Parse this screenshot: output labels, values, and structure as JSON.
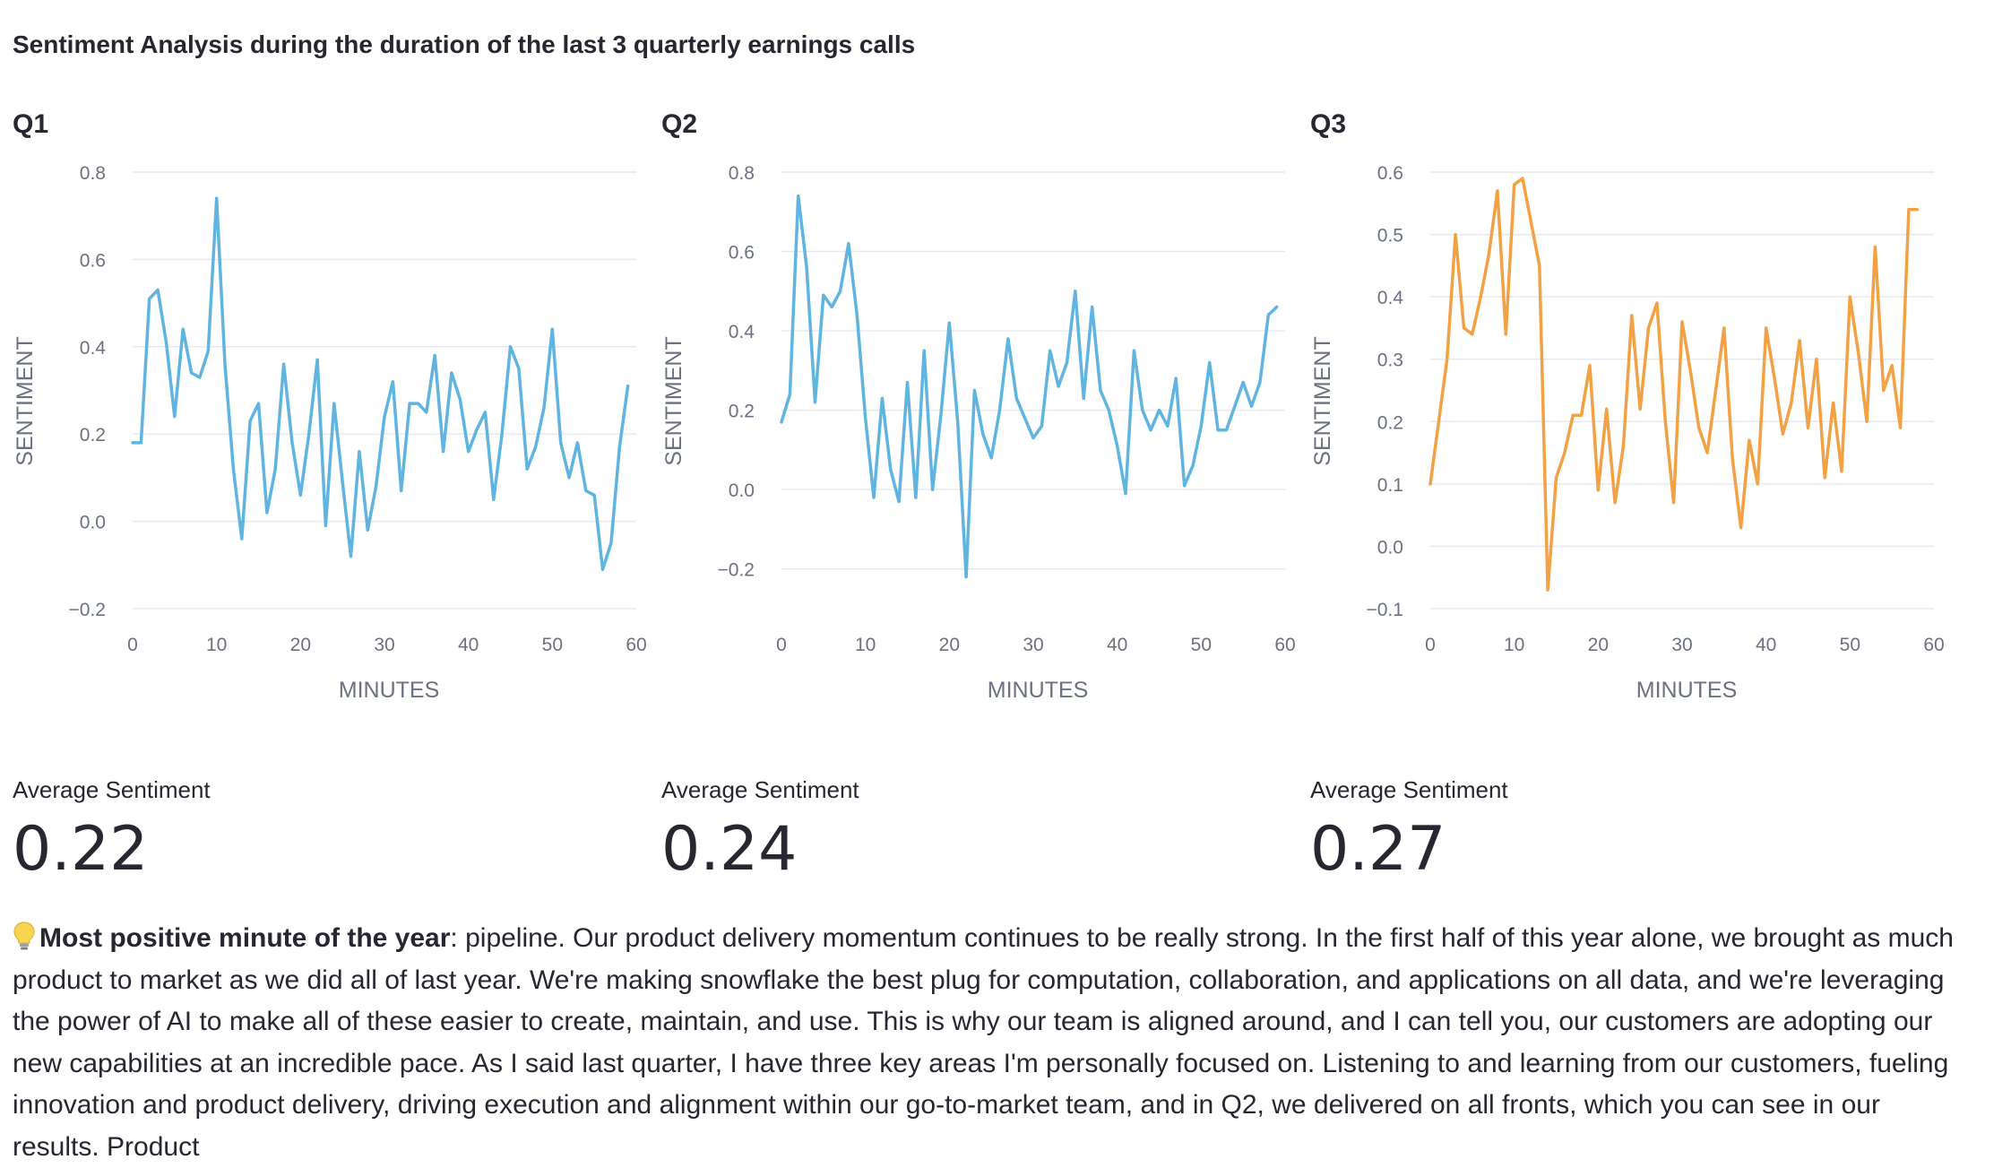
{
  "page": {
    "title": "Sentiment Analysis during the duration of the last 3 quarterly earnings calls"
  },
  "panels": [
    {
      "label": "Q1",
      "avg_label": "Average Sentiment",
      "avg_value": "0.22"
    },
    {
      "label": "Q2",
      "avg_label": "Average Sentiment",
      "avg_value": "0.24"
    },
    {
      "label": "Q3",
      "avg_label": "Average Sentiment",
      "avg_value": "0.27"
    }
  ],
  "insight": {
    "icon": "lightbulb-icon",
    "heading": "Most positive minute of the year",
    "text": ": pipeline. Our product delivery momentum continues to be really strong. In the first half of this year alone, we brought as much product to market as we did all of last year. We're making snowflake the best plug for computation, collaboration, and applications on all data, and we're leveraging the power of AI to make all of these easier to create, maintain, and use. This is why our team is aligned around, and I can tell you, our customers are adopting our new capabilities at an incredible pace. As I said last quarter, I have three key areas I'm personally focused on. Listening to and learning from our customers, fueling innovation and product delivery, driving execution and alignment within our go-to-market team, and in Q2, we delivered on all fronts, which you can see in our results. Product"
  },
  "chart_data": [
    {
      "type": "line",
      "xlabel": "MINUTES",
      "ylabel": "SENTIMENT",
      "xlim": [
        0,
        60
      ],
      "ylim": [
        -0.2,
        0.8
      ],
      "xticks": [
        0,
        10,
        20,
        30,
        40,
        50,
        60
      ],
      "yticks": [
        -0.2,
        0.0,
        0.2,
        0.4,
        0.6,
        0.8
      ],
      "ytick_labels": [
        "−0.2",
        "0.0",
        "0.2",
        "0.4",
        "0.6",
        "0.8"
      ],
      "grid": true,
      "color": "#5fb4e0",
      "x": [
        0,
        1,
        2,
        3,
        4,
        5,
        6,
        7,
        8,
        9,
        10,
        11,
        12,
        13,
        14,
        15,
        16,
        17,
        18,
        19,
        20,
        21,
        22,
        23,
        24,
        25,
        26,
        27,
        28,
        29,
        30,
        31,
        32,
        33,
        34,
        35,
        36,
        37,
        38,
        39,
        40,
        41,
        42,
        43,
        44,
        45,
        46,
        47,
        48,
        49,
        50,
        51,
        52,
        53,
        54,
        55,
        56,
        57,
        58,
        59
      ],
      "y": [
        0.18,
        0.18,
        0.51,
        0.53,
        0.41,
        0.24,
        0.44,
        0.34,
        0.33,
        0.39,
        0.74,
        0.36,
        0.12,
        -0.04,
        0.23,
        0.27,
        0.02,
        0.12,
        0.36,
        0.18,
        0.06,
        0.2,
        0.37,
        -0.01,
        0.27,
        0.09,
        -0.08,
        0.16,
        -0.02,
        0.08,
        0.24,
        0.32,
        0.07,
        0.27,
        0.27,
        0.25,
        0.38,
        0.16,
        0.34,
        0.28,
        0.16,
        0.21,
        0.25,
        0.05,
        0.2,
        0.4,
        0.35,
        0.12,
        0.17,
        0.26,
        0.44,
        0.18,
        0.1,
        0.18,
        0.07,
        0.06,
        -0.11,
        -0.05,
        0.17,
        0.31
      ]
    },
    {
      "type": "line",
      "xlabel": "MINUTES",
      "ylabel": "SENTIMENT",
      "xlim": [
        0,
        60
      ],
      "ylim": [
        -0.3,
        0.8
      ],
      "xticks": [
        0,
        10,
        20,
        30,
        40,
        50,
        60
      ],
      "yticks": [
        -0.2,
        0.0,
        0.2,
        0.4,
        0.6,
        0.8
      ],
      "ytick_labels": [
        "−0.2",
        "0.0",
        "0.2",
        "0.4",
        "0.6",
        "0.8"
      ],
      "grid": true,
      "color": "#5fb4e0",
      "x": [
        0,
        1,
        2,
        3,
        4,
        5,
        6,
        7,
        8,
        9,
        10,
        11,
        12,
        13,
        14,
        15,
        16,
        17,
        18,
        19,
        20,
        21,
        22,
        23,
        24,
        25,
        26,
        27,
        28,
        29,
        30,
        31,
        32,
        33,
        34,
        35,
        36,
        37,
        38,
        39,
        40,
        41,
        42,
        43,
        44,
        45,
        46,
        47,
        48,
        49,
        50,
        51,
        52,
        53,
        54,
        55,
        56,
        57,
        58,
        59
      ],
      "y": [
        0.17,
        0.24,
        0.74,
        0.56,
        0.22,
        0.49,
        0.46,
        0.5,
        0.62,
        0.44,
        0.18,
        -0.02,
        0.23,
        0.05,
        -0.03,
        0.27,
        -0.02,
        0.35,
        0.0,
        0.19,
        0.42,
        0.17,
        -0.22,
        0.25,
        0.14,
        0.08,
        0.2,
        0.38,
        0.23,
        0.18,
        0.13,
        0.16,
        0.35,
        0.26,
        0.32,
        0.5,
        0.23,
        0.46,
        0.25,
        0.2,
        0.11,
        -0.01,
        0.35,
        0.2,
        0.15,
        0.2,
        0.16,
        0.28,
        0.01,
        0.06,
        0.16,
        0.32,
        0.15,
        0.15,
        0.21,
        0.27,
        0.21,
        0.27,
        0.44,
        0.46
      ]
    },
    {
      "type": "line",
      "xlabel": "MINUTES",
      "ylabel": "SENTIMENT",
      "xlim": [
        0,
        60
      ],
      "ylim": [
        -0.1,
        0.6
      ],
      "xticks": [
        0,
        10,
        20,
        30,
        40,
        50,
        60
      ],
      "yticks": [
        -0.1,
        0.0,
        0.1,
        0.2,
        0.3,
        0.4,
        0.5,
        0.6
      ],
      "ytick_labels": [
        "−0.1",
        "0.0",
        "0.1",
        "0.2",
        "0.3",
        "0.4",
        "0.5",
        "0.6"
      ],
      "grid": true,
      "color": "#f2a144",
      "x": [
        0,
        1,
        2,
        3,
        4,
        5,
        6,
        7,
        8,
        9,
        10,
        11,
        12,
        13,
        14,
        15,
        16,
        17,
        18,
        19,
        20,
        21,
        22,
        23,
        24,
        25,
        26,
        27,
        28,
        29,
        30,
        31,
        32,
        33,
        34,
        35,
        36,
        37,
        38,
        39,
        40,
        41,
        42,
        43,
        44,
        45,
        46,
        47,
        48,
        49,
        50,
        51,
        52,
        53,
        54,
        55,
        56,
        57,
        58
      ],
      "y": [
        0.1,
        0.2,
        0.3,
        0.5,
        0.35,
        0.34,
        0.4,
        0.47,
        0.57,
        0.34,
        0.58,
        0.59,
        0.52,
        0.45,
        -0.07,
        0.11,
        0.15,
        0.21,
        0.21,
        0.29,
        0.09,
        0.22,
        0.07,
        0.16,
        0.37,
        0.22,
        0.35,
        0.39,
        0.2,
        0.07,
        0.36,
        0.28,
        0.19,
        0.15,
        0.25,
        0.35,
        0.14,
        0.03,
        0.17,
        0.1,
        0.35,
        0.27,
        0.18,
        0.23,
        0.33,
        0.19,
        0.3,
        0.11,
        0.23,
        0.12,
        0.4,
        0.31,
        0.2,
        0.48,
        0.25,
        0.29,
        0.19,
        0.54,
        0.54
      ]
    }
  ]
}
